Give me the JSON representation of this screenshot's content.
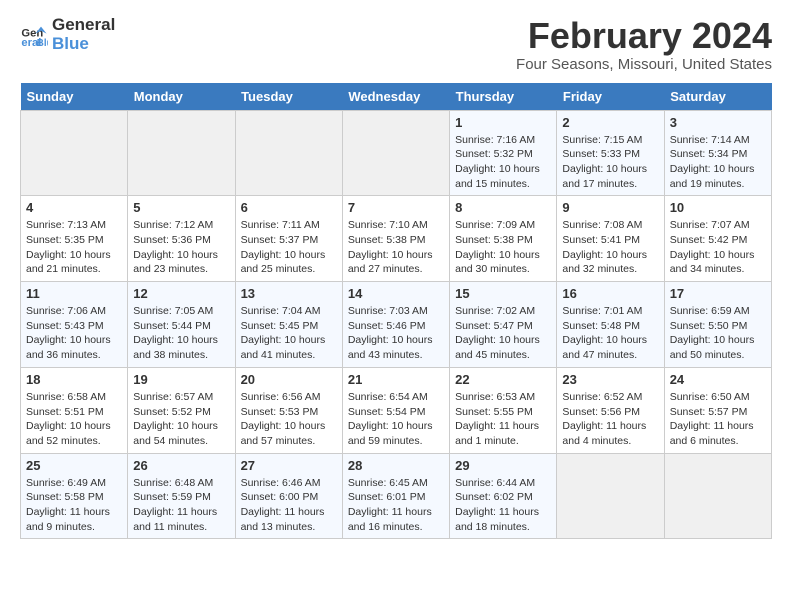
{
  "header": {
    "logo_line1": "General",
    "logo_line2": "Blue",
    "title": "February 2024",
    "subtitle": "Four Seasons, Missouri, United States"
  },
  "weekdays": [
    "Sunday",
    "Monday",
    "Tuesday",
    "Wednesday",
    "Thursday",
    "Friday",
    "Saturday"
  ],
  "weeks": [
    [
      {
        "day": "",
        "empty": true
      },
      {
        "day": "",
        "empty": true
      },
      {
        "day": "",
        "empty": true
      },
      {
        "day": "",
        "empty": true
      },
      {
        "day": "1",
        "sunrise": "7:16 AM",
        "sunset": "5:32 PM",
        "daylight": "10 hours and 15 minutes."
      },
      {
        "day": "2",
        "sunrise": "7:15 AM",
        "sunset": "5:33 PM",
        "daylight": "10 hours and 17 minutes."
      },
      {
        "day": "3",
        "sunrise": "7:14 AM",
        "sunset": "5:34 PM",
        "daylight": "10 hours and 19 minutes."
      }
    ],
    [
      {
        "day": "4",
        "sunrise": "7:13 AM",
        "sunset": "5:35 PM",
        "daylight": "10 hours and 21 minutes."
      },
      {
        "day": "5",
        "sunrise": "7:12 AM",
        "sunset": "5:36 PM",
        "daylight": "10 hours and 23 minutes."
      },
      {
        "day": "6",
        "sunrise": "7:11 AM",
        "sunset": "5:37 PM",
        "daylight": "10 hours and 25 minutes."
      },
      {
        "day": "7",
        "sunrise": "7:10 AM",
        "sunset": "5:38 PM",
        "daylight": "10 hours and 27 minutes."
      },
      {
        "day": "8",
        "sunrise": "7:09 AM",
        "sunset": "5:38 PM",
        "daylight": "10 hours and 30 minutes."
      },
      {
        "day": "9",
        "sunrise": "7:08 AM",
        "sunset": "5:41 PM",
        "daylight": "10 hours and 32 minutes."
      },
      {
        "day": "10",
        "sunrise": "7:07 AM",
        "sunset": "5:42 PM",
        "daylight": "10 hours and 34 minutes."
      }
    ],
    [
      {
        "day": "11",
        "sunrise": "7:06 AM",
        "sunset": "5:43 PM",
        "daylight": "10 hours and 36 minutes."
      },
      {
        "day": "12",
        "sunrise": "7:05 AM",
        "sunset": "5:44 PM",
        "daylight": "10 hours and 38 minutes."
      },
      {
        "day": "13",
        "sunrise": "7:04 AM",
        "sunset": "5:45 PM",
        "daylight": "10 hours and 41 minutes."
      },
      {
        "day": "14",
        "sunrise": "7:03 AM",
        "sunset": "5:46 PM",
        "daylight": "10 hours and 43 minutes."
      },
      {
        "day": "15",
        "sunrise": "7:02 AM",
        "sunset": "5:47 PM",
        "daylight": "10 hours and 45 minutes."
      },
      {
        "day": "16",
        "sunrise": "7:01 AM",
        "sunset": "5:48 PM",
        "daylight": "10 hours and 47 minutes."
      },
      {
        "day": "17",
        "sunrise": "6:59 AM",
        "sunset": "5:50 PM",
        "daylight": "10 hours and 50 minutes."
      }
    ],
    [
      {
        "day": "18",
        "sunrise": "6:58 AM",
        "sunset": "5:51 PM",
        "daylight": "10 hours and 52 minutes."
      },
      {
        "day": "19",
        "sunrise": "6:57 AM",
        "sunset": "5:52 PM",
        "daylight": "10 hours and 54 minutes."
      },
      {
        "day": "20",
        "sunrise": "6:56 AM",
        "sunset": "5:53 PM",
        "daylight": "10 hours and 57 minutes."
      },
      {
        "day": "21",
        "sunrise": "6:54 AM",
        "sunset": "5:54 PM",
        "daylight": "10 hours and 59 minutes."
      },
      {
        "day": "22",
        "sunrise": "6:53 AM",
        "sunset": "5:55 PM",
        "daylight": "11 hours and 1 minute."
      },
      {
        "day": "23",
        "sunrise": "6:52 AM",
        "sunset": "5:56 PM",
        "daylight": "11 hours and 4 minutes."
      },
      {
        "day": "24",
        "sunrise": "6:50 AM",
        "sunset": "5:57 PM",
        "daylight": "11 hours and 6 minutes."
      }
    ],
    [
      {
        "day": "25",
        "sunrise": "6:49 AM",
        "sunset": "5:58 PM",
        "daylight": "11 hours and 9 minutes."
      },
      {
        "day": "26",
        "sunrise": "6:48 AM",
        "sunset": "5:59 PM",
        "daylight": "11 hours and 11 minutes."
      },
      {
        "day": "27",
        "sunrise": "6:46 AM",
        "sunset": "6:00 PM",
        "daylight": "11 hours and 13 minutes."
      },
      {
        "day": "28",
        "sunrise": "6:45 AM",
        "sunset": "6:01 PM",
        "daylight": "11 hours and 16 minutes."
      },
      {
        "day": "29",
        "sunrise": "6:44 AM",
        "sunset": "6:02 PM",
        "daylight": "11 hours and 18 minutes."
      },
      {
        "day": "",
        "empty": true
      },
      {
        "day": "",
        "empty": true
      }
    ]
  ],
  "labels": {
    "sunrise_prefix": "Sunrise: ",
    "sunset_prefix": "Sunset: ",
    "daylight_prefix": "Daylight: "
  }
}
